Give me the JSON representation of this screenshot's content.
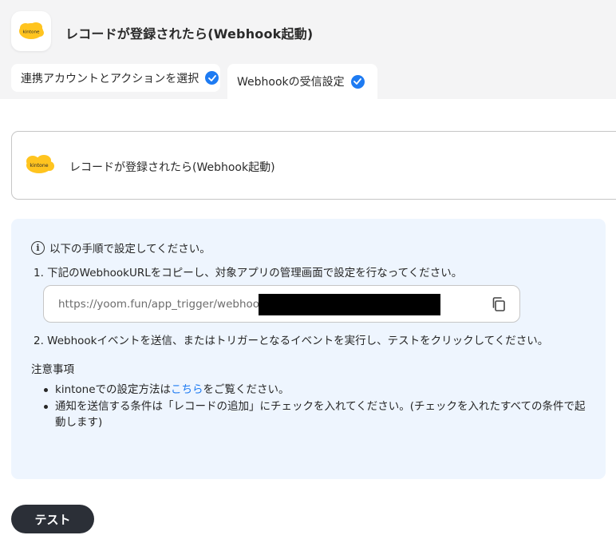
{
  "header": {
    "title": "レコードが登録されたら(Webhook起動)",
    "logo_text": "kintone"
  },
  "tabs": [
    {
      "label": "連携アカウントとアクションを選択",
      "done": true
    },
    {
      "label": "Webhookの受信設定",
      "done": true
    }
  ],
  "trigger": {
    "label": "レコードが登録されたら(Webhook起動)",
    "logo_text": "kintone"
  },
  "instructions": {
    "heading": "以下の手順で設定してください。",
    "step1": "1. 下記のWebhookURLをコピーし、対象アプリの管理画面で設定を行なってください。",
    "url": "https://yoom.fun/app_trigger/webhook",
    "step2": "2. Webhookイベントを送信、またはトリガーとなるイベントを実行し、テストをクリックしてください。"
  },
  "notes": {
    "title": "注意事項",
    "item1_prefix": "kintoneでの設定方法は",
    "item1_link": "こちら",
    "item1_suffix": "をご覧ください。",
    "item2": "通知を送信する条件は「レコードの追加」にチェックを入れてください。(チェックを入れたすべての条件で起動します)"
  },
  "actions": {
    "test_label": "テスト"
  },
  "colors": {
    "accent": "#1e7bf2",
    "kintone": "#ffc41f",
    "info_bg": "#eef5fe",
    "button_bg": "#2b2f37"
  }
}
